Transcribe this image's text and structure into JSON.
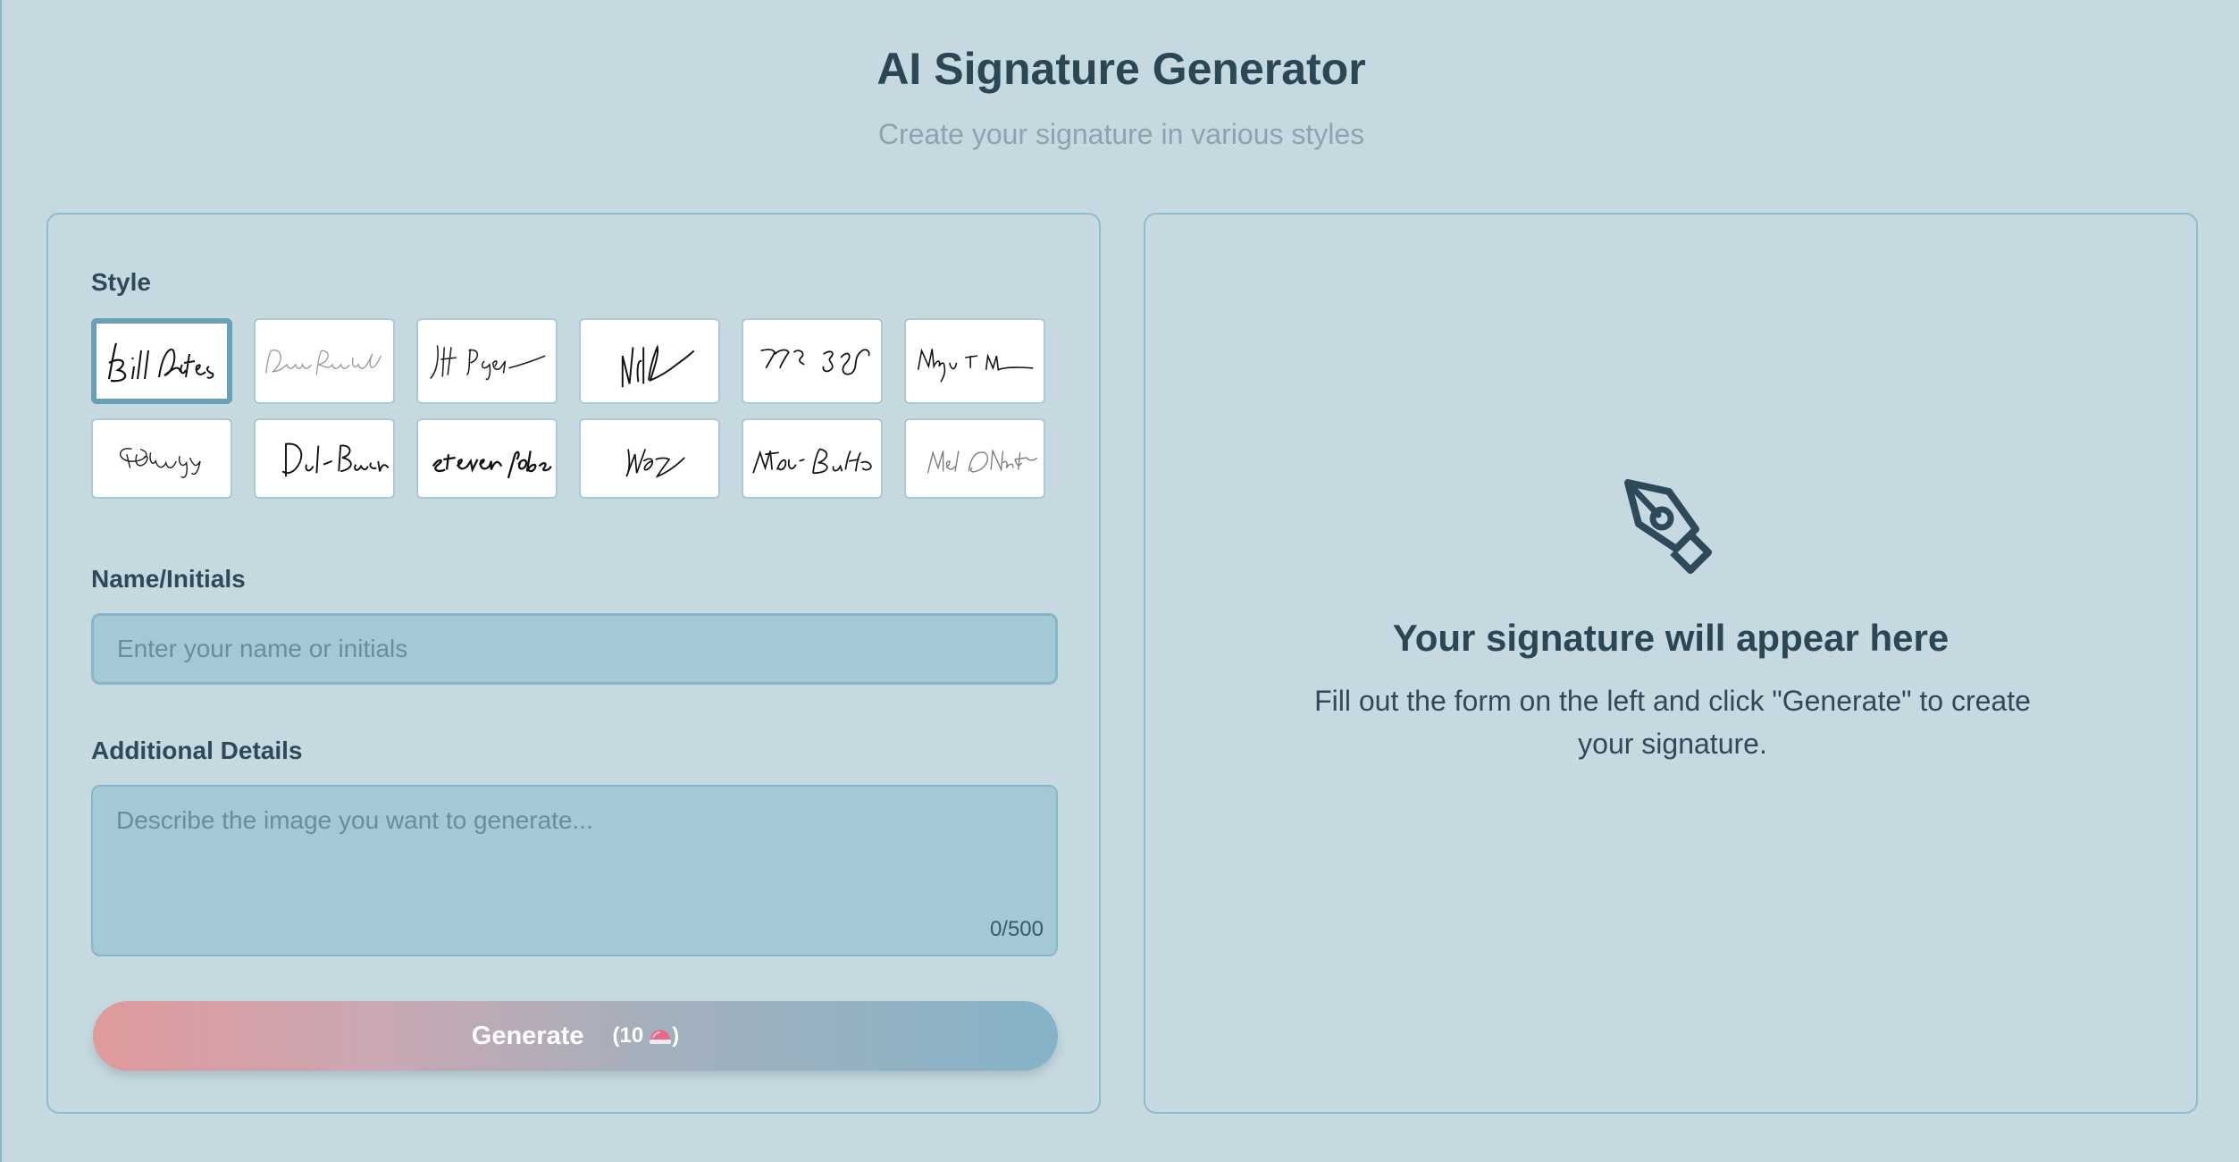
{
  "header": {
    "title": "AI Signature Generator",
    "subtitle": "Create your signature in various styles"
  },
  "form": {
    "style_label": "Style",
    "styles": [
      {
        "id": "style-1",
        "selected": true
      },
      {
        "id": "style-2",
        "selected": false
      },
      {
        "id": "style-3",
        "selected": false
      },
      {
        "id": "style-4",
        "selected": false
      },
      {
        "id": "style-5",
        "selected": false
      },
      {
        "id": "style-6",
        "selected": false
      },
      {
        "id": "style-7",
        "selected": false
      },
      {
        "id": "style-8",
        "selected": false
      },
      {
        "id": "style-9",
        "selected": false
      },
      {
        "id": "style-10",
        "selected": false
      },
      {
        "id": "style-11",
        "selected": false
      },
      {
        "id": "style-12",
        "selected": false
      }
    ],
    "name_label": "Name/Initials",
    "name_placeholder": "Enter your name or initials",
    "name_value": "",
    "details_label": "Additional Details",
    "details_placeholder": "Describe the image you want to generate...",
    "details_value": "",
    "char_count": "0/500",
    "generate_label": "Generate",
    "generate_cost": "(10",
    "generate_cost_close": ")"
  },
  "preview": {
    "title": "Your signature will appear here",
    "text": "Fill out the form on the left and click \"Generate\" to create your signature."
  },
  "colors": {
    "background": "#c7d9e0",
    "panel_border": "#8fbccc",
    "input_bg": "#a4c8d4",
    "accent": "#6b9fb5",
    "gradient_start": "#e09a9c",
    "gradient_end": "#85b3c7",
    "text_dark": "#2b4756"
  },
  "icons": {
    "pen_icon": "pen-nib-icon",
    "gem_icon": "gem-icon"
  }
}
